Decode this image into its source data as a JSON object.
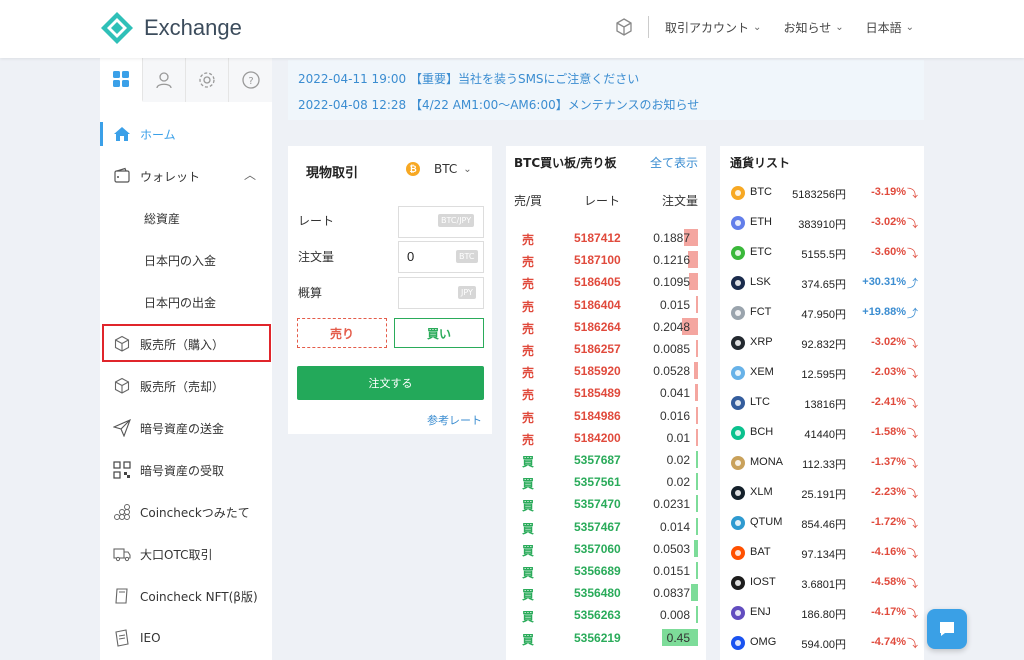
{
  "header": {
    "logo_text": "Exchange",
    "menus": [
      {
        "label": "取引アカウント"
      },
      {
        "label": "お知らせ"
      },
      {
        "label": "日本語"
      }
    ]
  },
  "notices": [
    {
      "text": "2022-04-11 19:00 【重要】当社を装うSMSにご注意ください"
    },
    {
      "text": "2022-04-08 12:28 【4/22 AM1:00〜AM6:00】メンテナンスのお知らせ"
    }
  ],
  "sidebar": {
    "tabs": [
      {
        "icon": "dashboard-icon"
      },
      {
        "icon": "user-icon"
      },
      {
        "icon": "gear-icon"
      },
      {
        "icon": "help-icon"
      }
    ],
    "items": [
      {
        "label": "ホーム",
        "icon": "home-icon"
      },
      {
        "label": "ウォレット",
        "icon": "wallet-icon"
      },
      {
        "label": "総資産"
      },
      {
        "label": "日本円の入金"
      },
      {
        "label": "日本円の出金"
      },
      {
        "label": "販売所（購入）",
        "icon": "cube-icon"
      },
      {
        "label": "販売所（売却）",
        "icon": "cube-icon"
      },
      {
        "label": "暗号資産の送金",
        "icon": "send-icon"
      },
      {
        "label": "暗号資産の受取",
        "icon": "qr-icon"
      },
      {
        "label": "Coincheckつみたて",
        "icon": "coins-icon"
      },
      {
        "label": "大口OTC取引",
        "icon": "truck-icon"
      },
      {
        "label": "Coincheck NFT(β版)",
        "icon": "nft-icon"
      },
      {
        "label": "IEO",
        "icon": "ieo-icon"
      }
    ]
  },
  "spot": {
    "title": "現物取引",
    "coin": "BTC",
    "rate_label": "レート",
    "rate_unit": "BTC/JPY",
    "qty_label": "注文量",
    "qty_value": "0",
    "qty_unit": "BTC",
    "est_label": "概算",
    "est_unit": "JPY",
    "sell_label": "売り",
    "buy_label": "買い",
    "order_label": "注文する",
    "ref_link": "参考レート"
  },
  "book": {
    "title": "BTC買い板/売り板",
    "show_all": "全て表示",
    "col_side": "売/買",
    "col_rate": "レート",
    "col_qty": "注文量",
    "rows": [
      {
        "side": "売",
        "rate": "5187412",
        "qty": "0.1887",
        "bar": 0.3
      },
      {
        "side": "売",
        "rate": "5187100",
        "qty": "0.1216",
        "bar": 0.2
      },
      {
        "side": "売",
        "rate": "5186405",
        "qty": "0.1095",
        "bar": 0.18
      },
      {
        "side": "売",
        "rate": "5186404",
        "qty": "0.015",
        "bar": 0.03
      },
      {
        "side": "売",
        "rate": "5186264",
        "qty": "0.2048",
        "bar": 0.33
      },
      {
        "side": "売",
        "rate": "5186257",
        "qty": "0.0085",
        "bar": 0.02
      },
      {
        "side": "売",
        "rate": "5185920",
        "qty": "0.0528",
        "bar": 0.09
      },
      {
        "side": "売",
        "rate": "5185489",
        "qty": "0.041",
        "bar": 0.07
      },
      {
        "side": "売",
        "rate": "5184986",
        "qty": "0.016",
        "bar": 0.03
      },
      {
        "side": "売",
        "rate": "5184200",
        "qty": "0.01",
        "bar": 0.02
      },
      {
        "side": "買",
        "rate": "5357687",
        "qty": "0.02",
        "bar": 0.03
      },
      {
        "side": "買",
        "rate": "5357561",
        "qty": "0.02",
        "bar": 0.03
      },
      {
        "side": "買",
        "rate": "5357470",
        "qty": "0.0231",
        "bar": 0.04
      },
      {
        "side": "買",
        "rate": "5357467",
        "qty": "0.014",
        "bar": 0.02
      },
      {
        "side": "買",
        "rate": "5357060",
        "qty": "0.0503",
        "bar": 0.08
      },
      {
        "side": "買",
        "rate": "5356689",
        "qty": "0.0151",
        "bar": 0.03
      },
      {
        "side": "買",
        "rate": "5356480",
        "qty": "0.0837",
        "bar": 0.14
      },
      {
        "side": "買",
        "rate": "5356263",
        "qty": "0.008",
        "bar": 0.02
      },
      {
        "side": "買",
        "rate": "5356219",
        "qty": "0.45",
        "bar": 0.75
      }
    ]
  },
  "clist": {
    "title": "通貨リスト",
    "rows": [
      {
        "sym": "BTC",
        "price": "5183256円",
        "chg": "-3.19%",
        "dir": "down",
        "color": "#f7a823"
      },
      {
        "sym": "ETH",
        "price": "383910円",
        "chg": "-3.02%",
        "dir": "down",
        "color": "#627eea"
      },
      {
        "sym": "ETC",
        "price": "5155.5円",
        "chg": "-3.60%",
        "dir": "down",
        "color": "#3ab83a"
      },
      {
        "sym": "LSK",
        "price": "374.65円",
        "chg": "+30.31%",
        "dir": "up",
        "color": "#1a2b4c"
      },
      {
        "sym": "FCT",
        "price": "47.950円",
        "chg": "+19.88%",
        "dir": "up",
        "color": "#9aa4ad"
      },
      {
        "sym": "XRP",
        "price": "92.832円",
        "chg": "-3.02%",
        "dir": "down",
        "color": "#23292f"
      },
      {
        "sym": "XEM",
        "price": "12.595円",
        "chg": "-2.03%",
        "dir": "down",
        "color": "#67b2e8"
      },
      {
        "sym": "LTC",
        "price": "13816円",
        "chg": "-2.41%",
        "dir": "down",
        "color": "#345d9d"
      },
      {
        "sym": "BCH",
        "price": "41440円",
        "chg": "-1.58%",
        "dir": "down",
        "color": "#0ac18e"
      },
      {
        "sym": "MONA",
        "price": "112.33円",
        "chg": "-1.37%",
        "dir": "down",
        "color": "#c9a15a"
      },
      {
        "sym": "XLM",
        "price": "25.191円",
        "chg": "-2.23%",
        "dir": "down",
        "color": "#14202a"
      },
      {
        "sym": "QTUM",
        "price": "854.46円",
        "chg": "-1.72%",
        "dir": "down",
        "color": "#2e9ad0"
      },
      {
        "sym": "BAT",
        "price": "97.134円",
        "chg": "-4.16%",
        "dir": "down",
        "color": "#ff5000"
      },
      {
        "sym": "IOST",
        "price": "3.6801円",
        "chg": "-4.58%",
        "dir": "down",
        "color": "#1c1c1c"
      },
      {
        "sym": "ENJ",
        "price": "186.80円",
        "chg": "-4.17%",
        "dir": "down",
        "color": "#624dbf"
      },
      {
        "sym": "OMG",
        "price": "594.00円",
        "chg": "-4.74%",
        "dir": "down",
        "color": "#1a53f0"
      }
    ]
  },
  "colors": {
    "accent": "#3ba0e8",
    "sell": "#e04a3c",
    "buy": "#2aab5a",
    "highlight": "#e0252b"
  }
}
